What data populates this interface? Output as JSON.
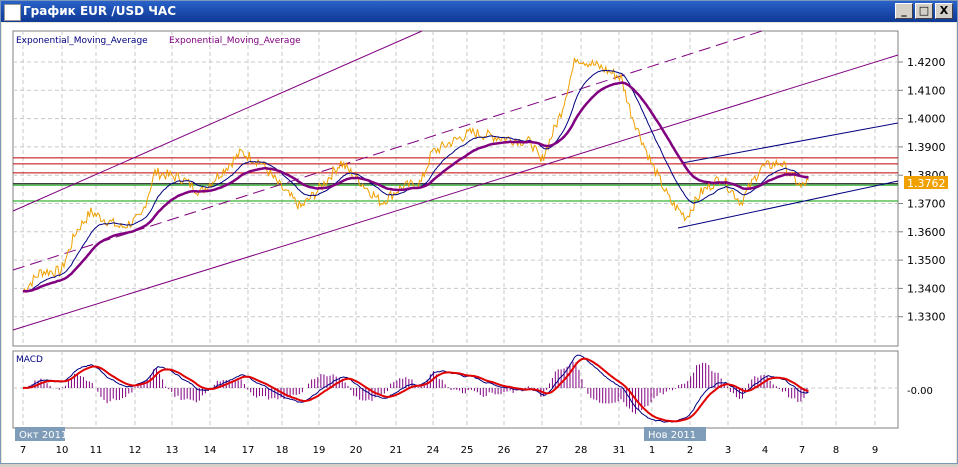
{
  "window": {
    "title": "График EUR /USD  ЧАС",
    "minimize": "_",
    "maximize": "□",
    "close": "X"
  },
  "legend": {
    "ema1": "Exponential_Moving_Average",
    "ema2": "Exponential_Moving_Average"
  },
  "macd_label": "MACD",
  "colors": {
    "price": "#f0a000",
    "ema_fast": "#000080",
    "ema_slow": "#800080",
    "macd": "#000080",
    "signal": "#e00000",
    "hist": "#800080",
    "current": "#f0a000"
  },
  "chart_data": {
    "type": "line",
    "title": "EUR/USD H1",
    "y_ticks": [
      "1.4200",
      "1.4100",
      "1.4000",
      "1.3900",
      "1.3800",
      "1.3700",
      "1.3600",
      "1.3500",
      "1.3400",
      "1.3300"
    ],
    "ylim": [
      1.325,
      1.435
    ],
    "current_price": "1.3762",
    "x_ticks": [
      "7",
      "10",
      "11",
      "12",
      "13",
      "14",
      "17",
      "18",
      "19",
      "20",
      "21",
      "24",
      "25",
      "26",
      "27",
      "28",
      "31",
      "1",
      "2",
      "3",
      "4",
      "7",
      "8",
      "9"
    ],
    "month_labels": [
      {
        "label": "Окт 2011",
        "at": 0
      },
      {
        "label": "Нов 2011",
        "at": 17
      }
    ],
    "price": [
      [
        0,
        1.339
      ],
      [
        0.46,
        1.346
      ],
      [
        0.97,
        1.346
      ],
      [
        1.41,
        1.36
      ],
      [
        1.85,
        1.367
      ],
      [
        2.64,
        1.3615
      ],
      [
        3.16,
        1.365
      ],
      [
        3.54,
        1.381
      ],
      [
        4.24,
        1.379
      ],
      [
        4.76,
        1.374
      ],
      [
        5.82,
        1.388
      ],
      [
        6.38,
        1.3845
      ],
      [
        6.97,
        1.3757
      ],
      [
        7.51,
        1.3686
      ],
      [
        8.05,
        1.3757
      ],
      [
        8.59,
        1.3845
      ],
      [
        9.13,
        1.3774
      ],
      [
        9.63,
        1.3704
      ],
      [
        10.14,
        1.3757
      ],
      [
        10.68,
        1.3774
      ],
      [
        10.97,
        1.388
      ],
      [
        11.53,
        1.3916
      ],
      [
        12.12,
        1.3951
      ],
      [
        12.92,
        1.3933
      ],
      [
        13.72,
        1.3916
      ],
      [
        13.97,
        1.3845
      ],
      [
        14.49,
        1.4022
      ],
      [
        14.87,
        1.4216
      ],
      [
        15.53,
        1.418
      ],
      [
        16.06,
        1.4145
      ],
      [
        16.36,
        1.4022
      ],
      [
        16.97,
        1.3845
      ],
      [
        17.5,
        1.3704
      ],
      [
        17.9,
        1.3651
      ],
      [
        18.29,
        1.3739
      ],
      [
        18.82,
        1.3792
      ],
      [
        19.35,
        1.3704
      ],
      [
        19.89,
        1.3827
      ],
      [
        20.43,
        1.3845
      ],
      [
        20.97,
        1.3757
      ],
      [
        21.19,
        1.3781
      ]
    ],
    "levels": {
      "red": [
        1.3861,
        1.384,
        1.3808
      ],
      "green": [
        1.3765,
        1.3709
      ],
      "black": [
        1.377
      ]
    },
    "macd_tick": "-0.00"
  }
}
